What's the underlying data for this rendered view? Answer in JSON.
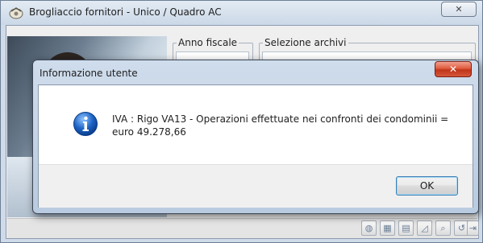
{
  "main_window": {
    "title": "Brogliaccio fornitori  - Unico / Quadro AC",
    "close_glyph": "✕",
    "group_anno": {
      "label": "Anno fiscale"
    },
    "group_selezione": {
      "label": "Selezione archivi"
    },
    "toolbar_icons": [
      "globe-icon",
      "grid-icon",
      "page-icon",
      "text-icon",
      "search-icon",
      "undo-icon",
      "exit-icon"
    ]
  },
  "dialog": {
    "title": "Informazione utente",
    "close_glyph": "✕",
    "icon": "info-icon",
    "message": "IVA : Rigo VA13 - Operazioni effettuate nei confronti dei condominii = euro 49.278,66",
    "ok_label": "OK"
  },
  "colors": {
    "dialog_close": "#c83b1f",
    "ok_border": "#3c7fb1",
    "info_icon": "#1c62c4"
  }
}
